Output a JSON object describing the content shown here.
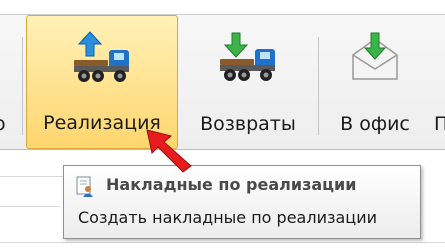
{
  "toolbar": {
    "left_clipped_label": "о",
    "buttons": [
      {
        "label": "Реализация",
        "icon": "truck-upload-icon"
      },
      {
        "label": "Возвраты",
        "icon": "truck-download-icon"
      },
      {
        "label": "В офис",
        "icon": "envelope-download-icon"
      }
    ],
    "right_clipped_label": "П",
    "active_color": "#ffd66e"
  },
  "tooltip": {
    "icon": "document-user-icon",
    "title": "Накладные по реализации",
    "description": "Создать накладные по реализации"
  },
  "cursor": {
    "icon": "red-arrow-cursor-icon",
    "color": "#e81c1c"
  }
}
